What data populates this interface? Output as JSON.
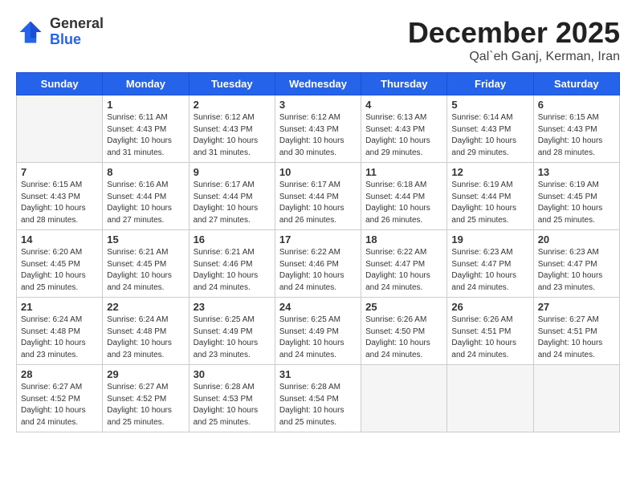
{
  "header": {
    "logo_general": "General",
    "logo_blue": "Blue",
    "month_title": "December 2025",
    "location": "Qal`eh Ganj, Kerman, Iran"
  },
  "days_of_week": [
    "Sunday",
    "Monday",
    "Tuesday",
    "Wednesday",
    "Thursday",
    "Friday",
    "Saturday"
  ],
  "weeks": [
    [
      {
        "day": "",
        "info": ""
      },
      {
        "day": "1",
        "info": "Sunrise: 6:11 AM\nSunset: 4:43 PM\nDaylight: 10 hours\nand 31 minutes."
      },
      {
        "day": "2",
        "info": "Sunrise: 6:12 AM\nSunset: 4:43 PM\nDaylight: 10 hours\nand 31 minutes."
      },
      {
        "day": "3",
        "info": "Sunrise: 6:12 AM\nSunset: 4:43 PM\nDaylight: 10 hours\nand 30 minutes."
      },
      {
        "day": "4",
        "info": "Sunrise: 6:13 AM\nSunset: 4:43 PM\nDaylight: 10 hours\nand 29 minutes."
      },
      {
        "day": "5",
        "info": "Sunrise: 6:14 AM\nSunset: 4:43 PM\nDaylight: 10 hours\nand 29 minutes."
      },
      {
        "day": "6",
        "info": "Sunrise: 6:15 AM\nSunset: 4:43 PM\nDaylight: 10 hours\nand 28 minutes."
      }
    ],
    [
      {
        "day": "7",
        "info": "Sunrise: 6:15 AM\nSunset: 4:43 PM\nDaylight: 10 hours\nand 28 minutes."
      },
      {
        "day": "8",
        "info": "Sunrise: 6:16 AM\nSunset: 4:44 PM\nDaylight: 10 hours\nand 27 minutes."
      },
      {
        "day": "9",
        "info": "Sunrise: 6:17 AM\nSunset: 4:44 PM\nDaylight: 10 hours\nand 27 minutes."
      },
      {
        "day": "10",
        "info": "Sunrise: 6:17 AM\nSunset: 4:44 PM\nDaylight: 10 hours\nand 26 minutes."
      },
      {
        "day": "11",
        "info": "Sunrise: 6:18 AM\nSunset: 4:44 PM\nDaylight: 10 hours\nand 26 minutes."
      },
      {
        "day": "12",
        "info": "Sunrise: 6:19 AM\nSunset: 4:44 PM\nDaylight: 10 hours\nand 25 minutes."
      },
      {
        "day": "13",
        "info": "Sunrise: 6:19 AM\nSunset: 4:45 PM\nDaylight: 10 hours\nand 25 minutes."
      }
    ],
    [
      {
        "day": "14",
        "info": "Sunrise: 6:20 AM\nSunset: 4:45 PM\nDaylight: 10 hours\nand 25 minutes."
      },
      {
        "day": "15",
        "info": "Sunrise: 6:21 AM\nSunset: 4:45 PM\nDaylight: 10 hours\nand 24 minutes."
      },
      {
        "day": "16",
        "info": "Sunrise: 6:21 AM\nSunset: 4:46 PM\nDaylight: 10 hours\nand 24 minutes."
      },
      {
        "day": "17",
        "info": "Sunrise: 6:22 AM\nSunset: 4:46 PM\nDaylight: 10 hours\nand 24 minutes."
      },
      {
        "day": "18",
        "info": "Sunrise: 6:22 AM\nSunset: 4:47 PM\nDaylight: 10 hours\nand 24 minutes."
      },
      {
        "day": "19",
        "info": "Sunrise: 6:23 AM\nSunset: 4:47 PM\nDaylight: 10 hours\nand 24 minutes."
      },
      {
        "day": "20",
        "info": "Sunrise: 6:23 AM\nSunset: 4:47 PM\nDaylight: 10 hours\nand 23 minutes."
      }
    ],
    [
      {
        "day": "21",
        "info": "Sunrise: 6:24 AM\nSunset: 4:48 PM\nDaylight: 10 hours\nand 23 minutes."
      },
      {
        "day": "22",
        "info": "Sunrise: 6:24 AM\nSunset: 4:48 PM\nDaylight: 10 hours\nand 23 minutes."
      },
      {
        "day": "23",
        "info": "Sunrise: 6:25 AM\nSunset: 4:49 PM\nDaylight: 10 hours\nand 23 minutes."
      },
      {
        "day": "24",
        "info": "Sunrise: 6:25 AM\nSunset: 4:49 PM\nDaylight: 10 hours\nand 24 minutes."
      },
      {
        "day": "25",
        "info": "Sunrise: 6:26 AM\nSunset: 4:50 PM\nDaylight: 10 hours\nand 24 minutes."
      },
      {
        "day": "26",
        "info": "Sunrise: 6:26 AM\nSunset: 4:51 PM\nDaylight: 10 hours\nand 24 minutes."
      },
      {
        "day": "27",
        "info": "Sunrise: 6:27 AM\nSunset: 4:51 PM\nDaylight: 10 hours\nand 24 minutes."
      }
    ],
    [
      {
        "day": "28",
        "info": "Sunrise: 6:27 AM\nSunset: 4:52 PM\nDaylight: 10 hours\nand 24 minutes."
      },
      {
        "day": "29",
        "info": "Sunrise: 6:27 AM\nSunset: 4:52 PM\nDaylight: 10 hours\nand 25 minutes."
      },
      {
        "day": "30",
        "info": "Sunrise: 6:28 AM\nSunset: 4:53 PM\nDaylight: 10 hours\nand 25 minutes."
      },
      {
        "day": "31",
        "info": "Sunrise: 6:28 AM\nSunset: 4:54 PM\nDaylight: 10 hours\nand 25 minutes."
      },
      {
        "day": "",
        "info": ""
      },
      {
        "day": "",
        "info": ""
      },
      {
        "day": "",
        "info": ""
      }
    ]
  ]
}
